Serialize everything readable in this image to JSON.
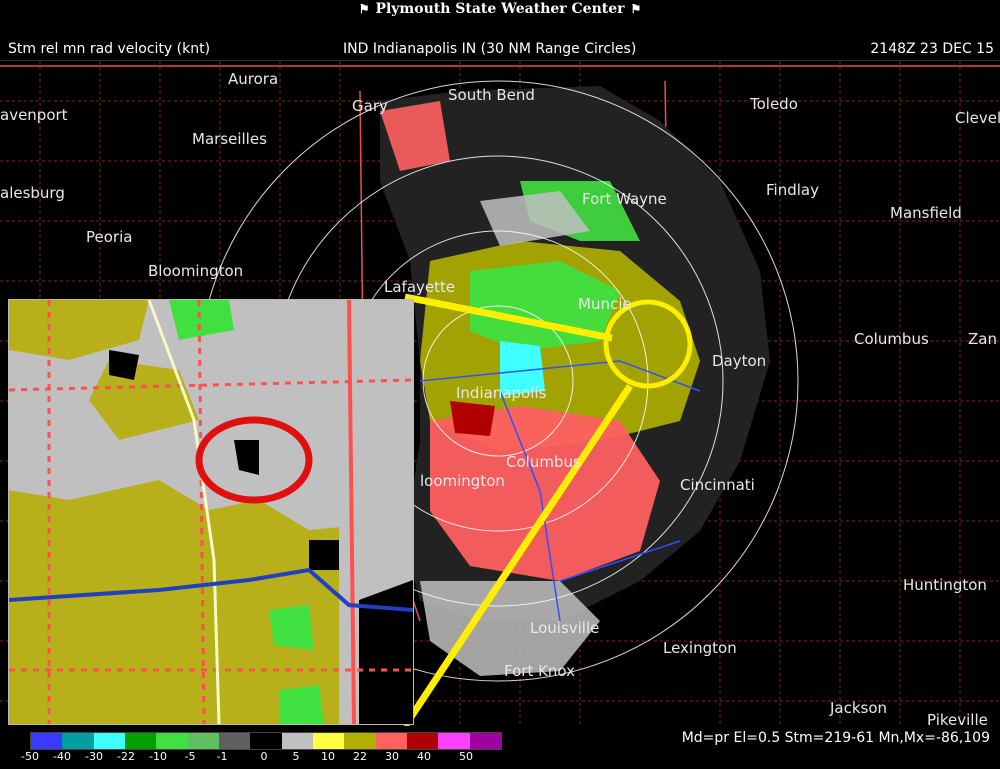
{
  "banner": {
    "title": "Plymouth State Weather Center"
  },
  "header": {
    "product": "Stm rel mn rad velocity (knt)",
    "site": "IND Indianapolis IN (30 NM Range Circles)",
    "timestamp": "2148Z 23 DEC 15"
  },
  "cities": [
    {
      "name": "Aurora"
    },
    {
      "name": "avenport"
    },
    {
      "name": "Marseilles"
    },
    {
      "name": "alesburg"
    },
    {
      "name": "Peoria"
    },
    {
      "name": "Bloomington"
    },
    {
      "name": "Gary"
    },
    {
      "name": "South Bend"
    },
    {
      "name": "Toledo"
    },
    {
      "name": "Clevel"
    },
    {
      "name": "Findlay"
    },
    {
      "name": "Mansfield"
    },
    {
      "name": "Fort Wayne"
    },
    {
      "name": "Lafayette"
    },
    {
      "name": "Muncie"
    },
    {
      "name": "Columbus"
    },
    {
      "name": "Zan"
    },
    {
      "name": "Dayton"
    },
    {
      "name": "Indianapolis"
    },
    {
      "name": "Columbus"
    },
    {
      "name": "loomington"
    },
    {
      "name": "Cincinnati"
    },
    {
      "name": "Huntington"
    },
    {
      "name": "Louisville"
    },
    {
      "name": "Fort Knox"
    },
    {
      "name": "Lexington"
    },
    {
      "name": "Jackson"
    },
    {
      "name": "Pikeville"
    }
  ],
  "colors": {
    "highlight_circle": "#ffee00",
    "inset_marker": "#e01010",
    "range_circle": "#ffffff",
    "county_lines": "#c83a3a"
  },
  "colorbar": {
    "swatches": [
      "#3a3aff",
      "#00a0a0",
      "#40ffff",
      "#00a000",
      "#40e040",
      "#60c060",
      "#606060",
      "#000000",
      "#c0c0c0",
      "#ffff40",
      "#b0b000",
      "#ff6060",
      "#b00000",
      "#ff40ff",
      "#a000a0"
    ],
    "labels": [
      "-50",
      "-40",
      "-30",
      "-22",
      "-10",
      "-5",
      "-1",
      "0",
      "5",
      "10",
      "22",
      "30",
      "40",
      "50"
    ]
  },
  "footer": {
    "info": "Md=pr El=0.5 Stm=219-61 Mn,Mx=-86,109"
  }
}
